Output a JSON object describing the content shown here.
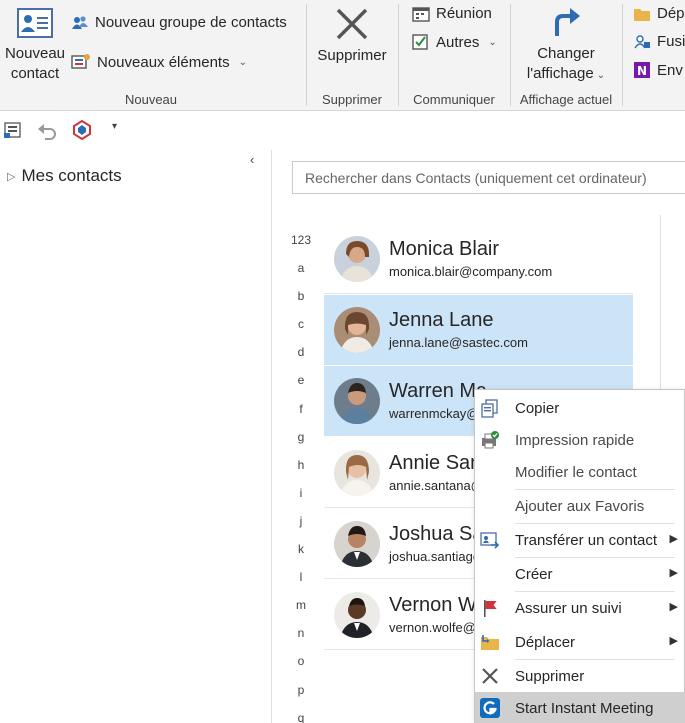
{
  "ribbon": {
    "new_contact": {
      "line1": "Nouveau",
      "line2": "contact"
    },
    "new_group": "Nouveau groupe de contacts",
    "new_items": "Nouveaux éléments",
    "group_new": "Nouveau",
    "delete": "Supprimer",
    "group_delete": "Supprimer",
    "meeting": "Réunion",
    "others": "Autres",
    "group_communicate": "Communiquer",
    "change_view": {
      "line1": "Changer",
      "line2": "l'affichage"
    },
    "group_view": "Affichage actuel",
    "move_to": "Dép",
    "merge": "Fusi",
    "send": "Env"
  },
  "left_pane": {
    "folder": "Mes contacts"
  },
  "search": {
    "placeholder": "Rechercher dans Contacts (uniquement cet ordinateur)"
  },
  "alphabet": [
    "123",
    "a",
    "b",
    "c",
    "d",
    "e",
    "f",
    "g",
    "h",
    "i",
    "j",
    "k",
    "l",
    "m",
    "n",
    "o",
    "p",
    "q"
  ],
  "contacts": [
    {
      "name": "Monica Blair",
      "email": "monica.blair@company.com"
    },
    {
      "name": "Jenna Lane",
      "email": "jenna.lane@sastec.com"
    },
    {
      "name": "Warren Mc",
      "email": "warrenmckay@"
    },
    {
      "name": "Annie San",
      "email": "annie.santana@"
    },
    {
      "name": "Joshua Sa",
      "email": "joshua.santiago"
    },
    {
      "name": "Vernon W",
      "email": "vernon.wolfe@"
    }
  ],
  "context_menu": {
    "copy": "Copier",
    "quick_print": "Impression rapide",
    "edit_contact": "Modifier le contact",
    "add_favorites": "Ajouter aux Favoris",
    "forward_contact": "Transférer un contact",
    "create": "Créer",
    "follow_up": "Assurer un suivi",
    "move": "Déplacer",
    "delete": "Supprimer",
    "instant_meeting": "Start Instant Meeting"
  },
  "colors": {
    "selection": "#cce4f7",
    "accent": "#0f6cbd",
    "onenote": "#7719aa",
    "flag": "#d13438"
  }
}
